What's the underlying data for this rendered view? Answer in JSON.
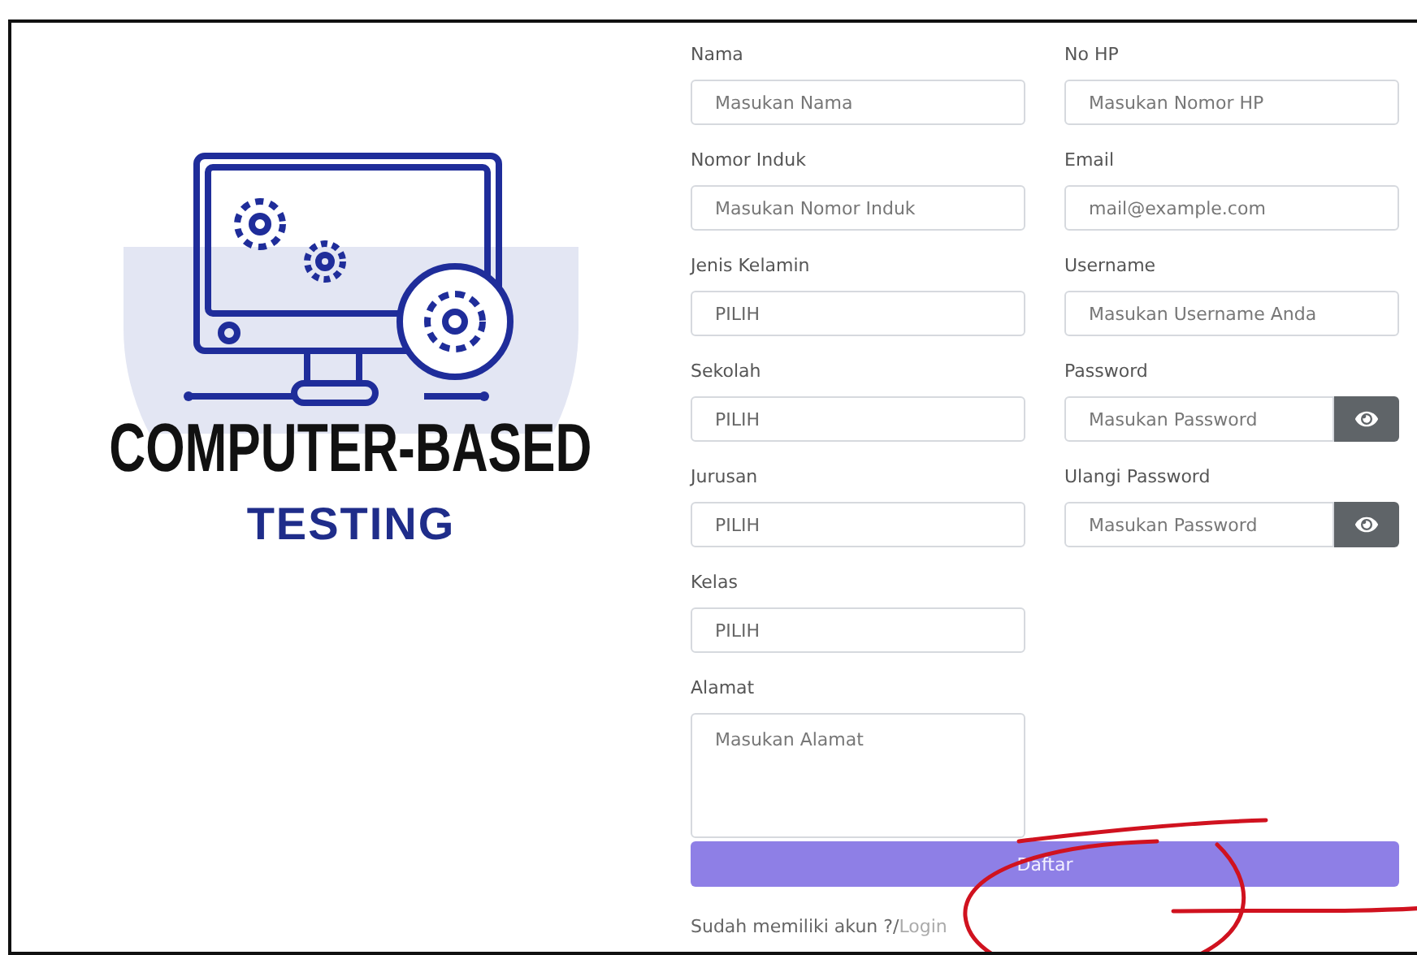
{
  "logo": {
    "title": "COMPUTER-BASED",
    "subtitle": "TESTING"
  },
  "form": {
    "left_fields": [
      {
        "label": "Nama",
        "kind": "text",
        "placeholder": "Masukan Nama"
      },
      {
        "label": "Nomor Induk",
        "kind": "text",
        "placeholder": "Masukan Nomor Induk"
      },
      {
        "label": "Jenis Kelamin",
        "kind": "select",
        "value": "PILIH"
      },
      {
        "label": "Sekolah",
        "kind": "select",
        "value": "PILIH"
      },
      {
        "label": "Jurusan",
        "kind": "select",
        "value": "PILIH"
      },
      {
        "label": "Kelas",
        "kind": "select",
        "value": "PILIH"
      },
      {
        "label": "Alamat",
        "kind": "textarea",
        "placeholder": "Masukan Alamat"
      }
    ],
    "right_fields": [
      {
        "label": "No HP",
        "kind": "text",
        "placeholder": "Masukan Nomor HP"
      },
      {
        "label": "Email",
        "kind": "text",
        "placeholder": "mail@example.com"
      },
      {
        "label": "Username",
        "kind": "text",
        "placeholder": "Masukan Username Anda"
      },
      {
        "label": "Password",
        "kind": "password",
        "placeholder": "Masukan Password"
      },
      {
        "label": "Ulangi Password",
        "kind": "password",
        "placeholder": "Masukan Password"
      }
    ],
    "submit": "Daftar",
    "login_prompt": "Sudah memiliki akun ?/",
    "login_link": "Login"
  }
}
